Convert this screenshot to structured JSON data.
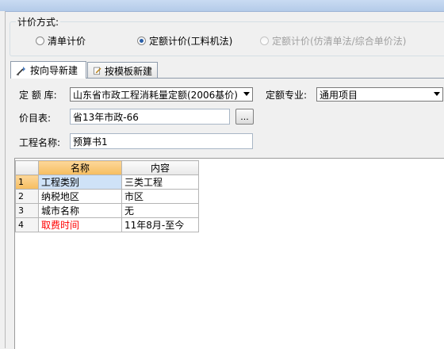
{
  "pricing": {
    "label": "计价方式:",
    "options": [
      {
        "label": "清单计价",
        "checked": false,
        "disabled": false
      },
      {
        "label": "定额计价(工料机法)",
        "checked": true,
        "disabled": false
      },
      {
        "label": "定额计价(仿清单法/综合单价法)",
        "checked": false,
        "disabled": true
      }
    ]
  },
  "tabs": [
    {
      "label": "按向导新建",
      "icon": "wizard-icon",
      "active": true
    },
    {
      "label": "按模板新建",
      "icon": "template-icon",
      "active": false
    }
  ],
  "form": {
    "quota_lib_label": "定 额 库:",
    "quota_lib_value": "山东省市政工程消耗量定额(2006基价)",
    "specialty_label": "定额专业:",
    "specialty_value": "通用项目",
    "price_table_label": "价目表:",
    "price_table_value": "省13年市政-66",
    "browse_label": "...",
    "project_name_label": "工程名称:",
    "project_name_value": "预算书1"
  },
  "grid": {
    "headers": [
      "名称",
      "内容"
    ],
    "rows": [
      {
        "num": "1",
        "name": "工程类别",
        "value": "三类工程",
        "name_color": "#000000"
      },
      {
        "num": "2",
        "name": "纳税地区",
        "value": "市区",
        "name_color": "#000000"
      },
      {
        "num": "3",
        "name": "城市名称",
        "value": "无",
        "name_color": "#000000"
      },
      {
        "num": "4",
        "name": "取费时间",
        "value": "11年8月-至今",
        "name_color": "#ff0000"
      }
    ]
  }
}
